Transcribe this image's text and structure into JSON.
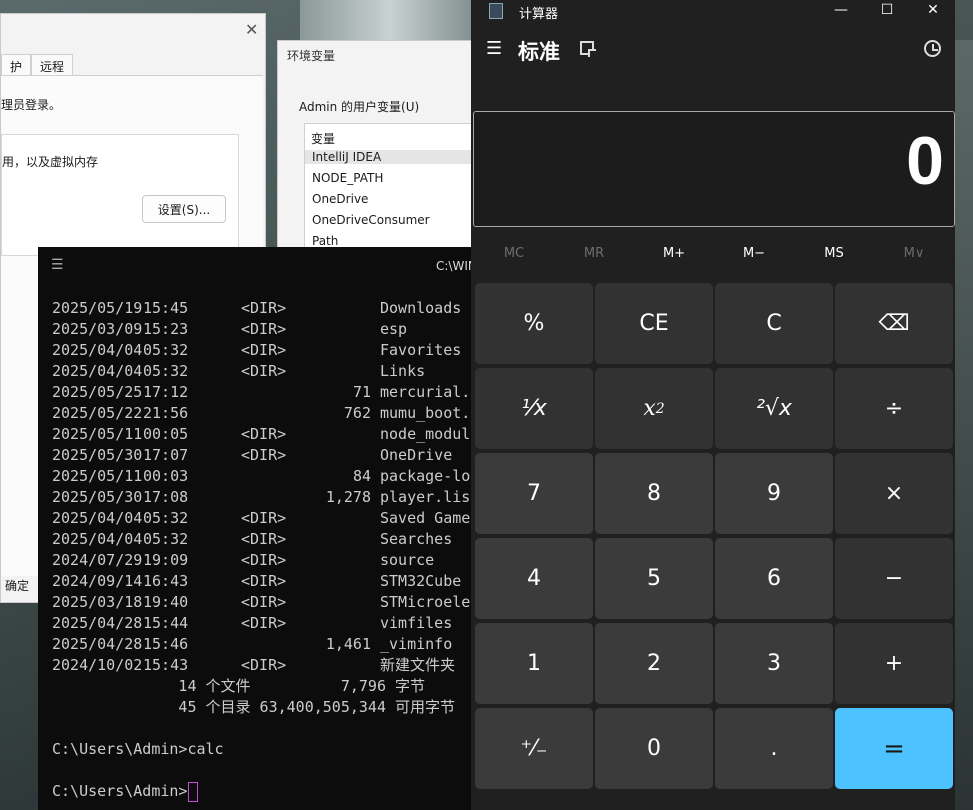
{
  "sysprops": {
    "tabs": [
      "护",
      "远程"
    ],
    "line1": "理员登录。",
    "group_text": "用，以及虚拟内存",
    "settings_button": "设置(S)...",
    "ok_button": "确定"
  },
  "envvars": {
    "title": "环境变量",
    "section_label": "Admin 的用户变量(U)",
    "list_header": "变量",
    "rows": [
      "IntelliJ IDEA",
      "NODE_PATH",
      "OneDrive",
      "OneDriveConsumer",
      "Path"
    ]
  },
  "terminal": {
    "title": "C:\\WIN",
    "entries": [
      {
        "date": "2025/05/19",
        "time": "15:45",
        "dir": "<DIR>",
        "size": "",
        "name": "Downloads"
      },
      {
        "date": "2025/03/09",
        "time": "15:23",
        "dir": "<DIR>",
        "size": "",
        "name": "esp"
      },
      {
        "date": "2025/04/04",
        "time": "05:32",
        "dir": "<DIR>",
        "size": "",
        "name": "Favorites"
      },
      {
        "date": "2025/04/04",
        "time": "05:32",
        "dir": "<DIR>",
        "size": "",
        "name": "Links"
      },
      {
        "date": "2025/05/25",
        "time": "17:12",
        "dir": "",
        "size": "71",
        "name": "mercurial.i"
      },
      {
        "date": "2025/05/22",
        "time": "21:56",
        "dir": "",
        "size": "762",
        "name": "mumu_boot.t"
      },
      {
        "date": "2025/05/11",
        "time": "00:05",
        "dir": "<DIR>",
        "size": "",
        "name": "node_module"
      },
      {
        "date": "2025/05/30",
        "time": "17:07",
        "dir": "<DIR>",
        "size": "",
        "name": "OneDrive"
      },
      {
        "date": "2025/05/11",
        "time": "00:03",
        "dir": "",
        "size": "84",
        "name": "package-loc"
      },
      {
        "date": "2025/05/30",
        "time": "17:08",
        "dir": "",
        "size": "1,278",
        "name": "player.list"
      },
      {
        "date": "2025/04/04",
        "time": "05:32",
        "dir": "<DIR>",
        "size": "",
        "name": "Saved Games"
      },
      {
        "date": "2025/04/04",
        "time": "05:32",
        "dir": "<DIR>",
        "size": "",
        "name": "Searches"
      },
      {
        "date": "2024/07/29",
        "time": "19:09",
        "dir": "<DIR>",
        "size": "",
        "name": "source"
      },
      {
        "date": "2024/09/14",
        "time": "16:43",
        "dir": "<DIR>",
        "size": "",
        "name": "STM32Cube"
      },
      {
        "date": "2025/03/18",
        "time": "19:40",
        "dir": "<DIR>",
        "size": "",
        "name": "STMicroelec"
      },
      {
        "date": "2025/04/28",
        "time": "15:44",
        "dir": "<DIR>",
        "size": "",
        "name": "vimfiles"
      },
      {
        "date": "2025/04/28",
        "time": "15:46",
        "dir": "",
        "size": "1,461",
        "name": "_viminfo"
      },
      {
        "date": "2024/10/02",
        "time": "15:43",
        "dir": "<DIR>",
        "size": "",
        "name": "新建文件夹"
      }
    ],
    "summary_files": "              14 个文件          7,796 字节",
    "summary_dirs": "              45 个目录 63,400,505,344 可用字节",
    "blank": "",
    "prompt_cmd": "C:\\Users\\Admin>calc",
    "prompt_current": "C:\\Users\\Admin>"
  },
  "calc": {
    "title": "计算器",
    "mode": "标准",
    "display_value": "0",
    "window_buttons": {
      "minimize": "—",
      "maximize": "☐",
      "close": "✕"
    },
    "memory": [
      "MC",
      "MR",
      "M+",
      "M−",
      "MS",
      "M∨"
    ],
    "keys": {
      "percent": "%",
      "ce": "CE",
      "c": "C",
      "backspace": "⌫",
      "reciprocal": "¹⁄x",
      "square_base": "x",
      "square_exp": "2",
      "sqrt": "²√x",
      "divide": "÷",
      "seven": "7",
      "eight": "8",
      "nine": "9",
      "multiply": "×",
      "four": "4",
      "five": "5",
      "six": "6",
      "minus": "−",
      "one": "1",
      "two": "2",
      "three": "3",
      "plus": "+",
      "negate": "⁺⁄₋",
      "zero": "0",
      "decimal": ".",
      "equals": "="
    },
    "accent_color": "#4cc2ff"
  }
}
